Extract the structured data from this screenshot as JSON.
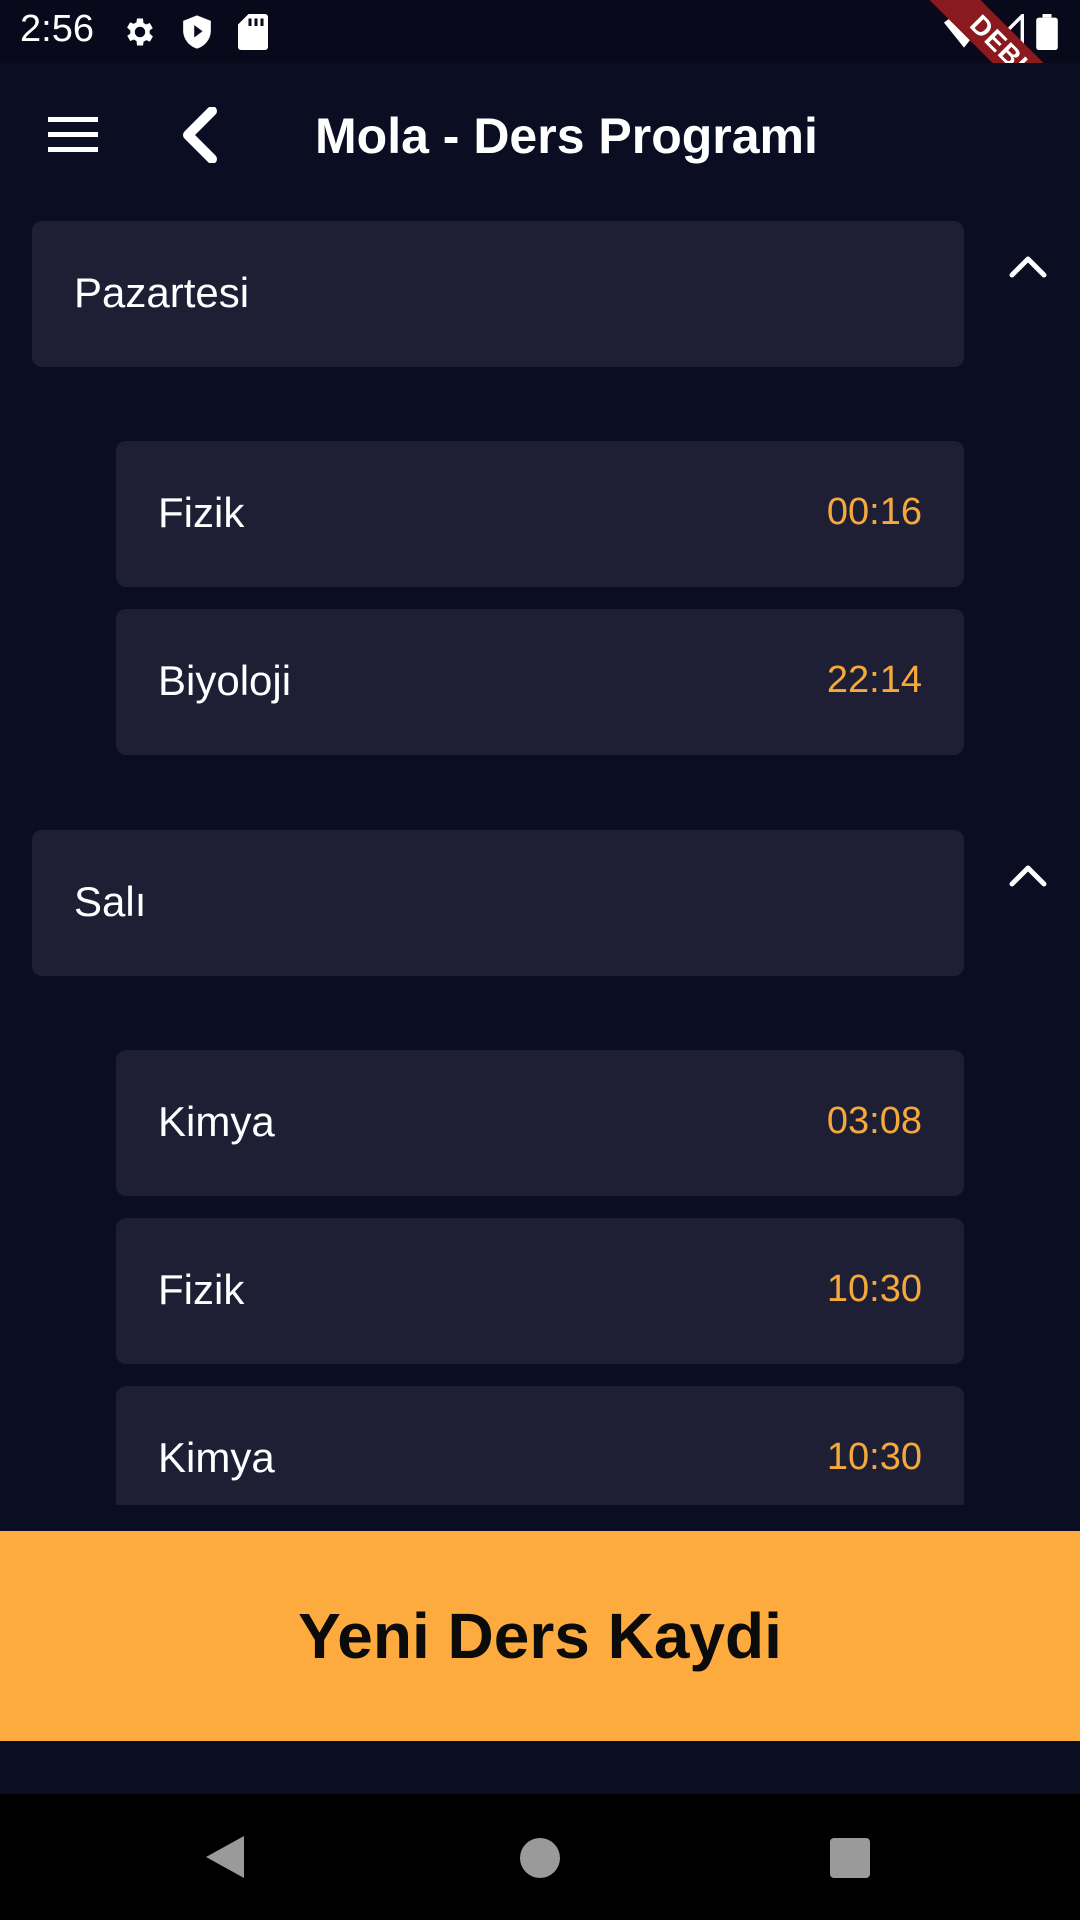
{
  "status_bar": {
    "time": "2:56",
    "icons": [
      "gear-icon",
      "shield-play-icon",
      "sd-card-icon",
      "wifi-icon",
      "signal-icon",
      "battery-icon"
    ]
  },
  "app_bar": {
    "title": "Mola - Ders Programi",
    "menu_icon": "menu-icon",
    "back_icon": "back-chevron-icon"
  },
  "debug_banner": "DEBUG",
  "schedule": [
    {
      "day": "Pazartesi",
      "expanded": true,
      "lessons": [
        {
          "name": "Fizik",
          "time": "00:16"
        },
        {
          "name": "Biyoloji",
          "time": "22:14"
        }
      ]
    },
    {
      "day": "Salı",
      "expanded": true,
      "lessons": [
        {
          "name": "Kimya",
          "time": "03:08"
        },
        {
          "name": "Fizik",
          "time": "10:30"
        },
        {
          "name": "Kimya",
          "time": "10:30"
        }
      ]
    }
  ],
  "new_lesson_button": "Yeni Ders Kaydi",
  "colors": {
    "background": "#0b0d22",
    "card": "#1e1f35",
    "accent": "#fdab3e",
    "time_text": "#f6a93b",
    "debug_ribbon": "#8b1a1f"
  },
  "nav_bar": {
    "icons": [
      "nav-back-icon",
      "nav-home-icon",
      "nav-recents-icon"
    ]
  }
}
